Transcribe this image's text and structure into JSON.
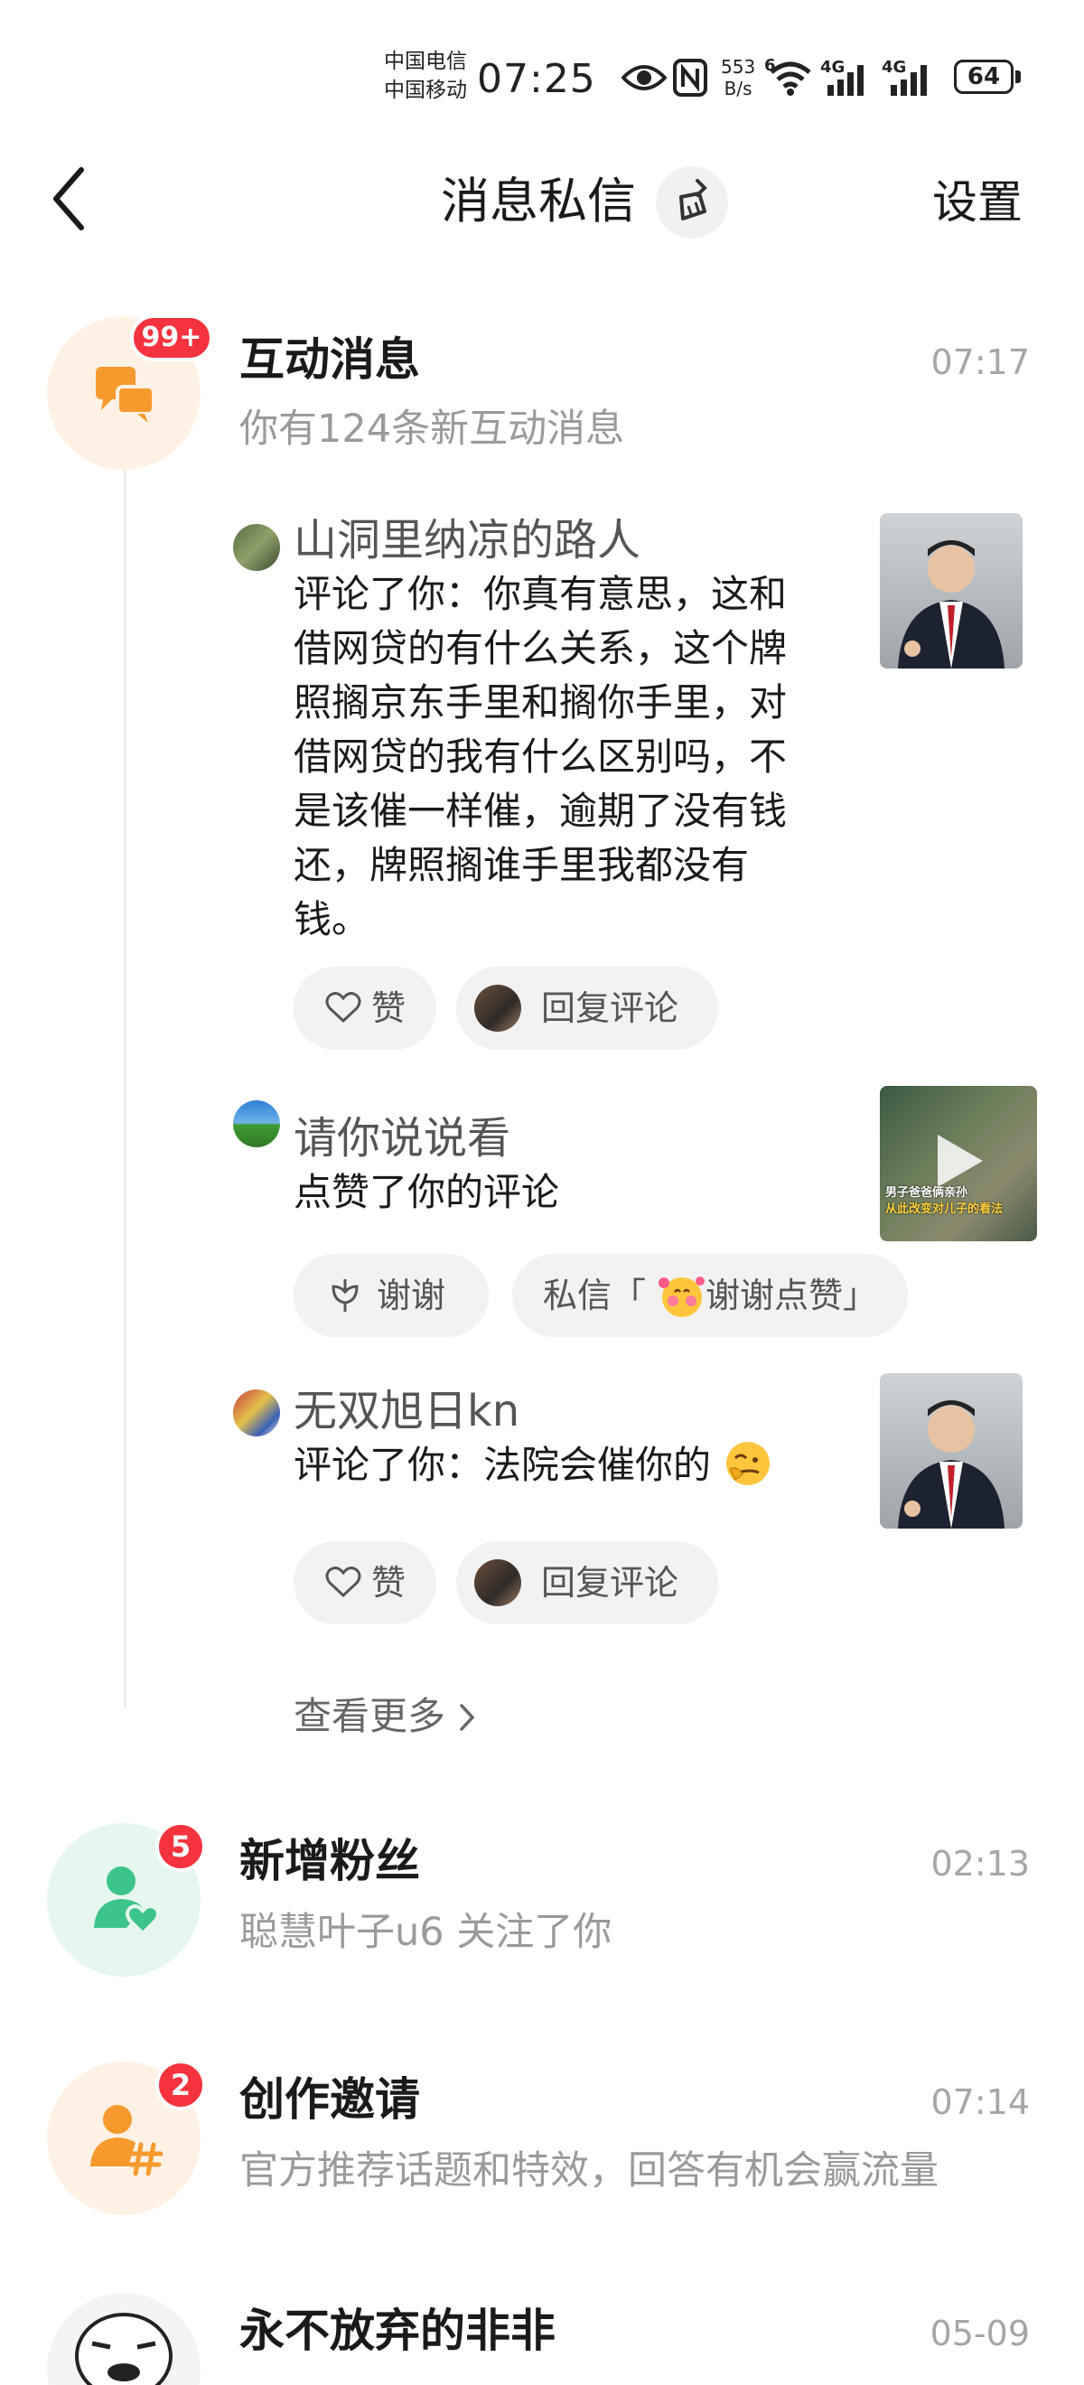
{
  "status_bar": {
    "carrier_1": "中国电信",
    "carrier_2": "中国移动",
    "time": "07:25",
    "net_speed_value": "553",
    "net_speed_unit": "B/s",
    "wifi_label": "6",
    "signal_1_label": "4G",
    "signal_2_label": "4G",
    "battery": "64"
  },
  "header": {
    "title": "消息私信",
    "settings_label": "设置"
  },
  "interactions": {
    "title": "互动消息",
    "time": "07:17",
    "subtitle": "你有124条新互动消息",
    "badge": "99+",
    "items": [
      {
        "name": "山洞里纳凉的路人",
        "text_lines": [
          "评论了你：你真有意思，这和",
          "借网贷的有什么关系，这个牌",
          "照搁京东手里和搁你手里，对",
          "借网贷的我有什么区别吗，不",
          "是该催一样催，逾期了没有钱",
          "还，牌照搁谁手里我都没有",
          "钱。"
        ],
        "like_label": "赞",
        "reply_label": "回复评论"
      },
      {
        "name": "请你说说看",
        "text": "点赞了你的评论",
        "thanks_label": "谢谢",
        "dm_prefix": "私信「",
        "dm_text": "谢谢点赞」",
        "thumb_caption_1": "男子爸爸俩亲孙",
        "thumb_caption_2": "从此改变对儿子的看法"
      },
      {
        "name": "无双旭日kn",
        "text": "评论了你：法院会催你的",
        "like_label": "赞",
        "reply_label": "回复评论"
      }
    ],
    "see_more": "查看更多"
  },
  "fans": {
    "title": "新增粉丝",
    "time": "02:13",
    "subtitle": "聪慧叶子u6 关注了你",
    "badge": "5"
  },
  "invite": {
    "title": "创作邀请",
    "time": "07:14",
    "subtitle": "官方推荐话题和特效，回答有机会赢流量",
    "badge": "2"
  },
  "chat": {
    "title": "永不放弃的非非",
    "time": "05-09"
  },
  "colors": {
    "accent_orange": "#f79a2e",
    "accent_green": "#3cc48a",
    "badge_red": "#f5333f",
    "orange_bg": "#fff2e4",
    "green_bg": "#e6f7ef"
  }
}
